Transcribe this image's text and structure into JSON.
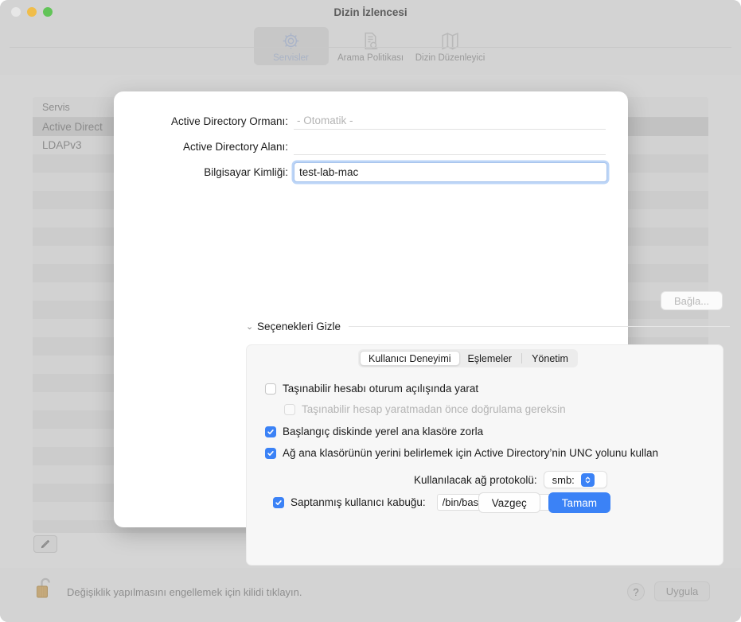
{
  "window": {
    "title": "Dizin İzlencesi",
    "traffic_lights": [
      "close",
      "minimize",
      "maximize"
    ]
  },
  "toolbar": {
    "items": [
      {
        "label": "Servisler",
        "icon": "gear-icon",
        "selected": true
      },
      {
        "label": "Arama Politikası",
        "icon": "document-search-icon",
        "selected": false
      },
      {
        "label": "Dizin Düzenleyici",
        "icon": "map-icon",
        "selected": false
      }
    ]
  },
  "service_list": {
    "header": "Servis",
    "rows": [
      {
        "label": "Active Direct",
        "selected": true
      },
      {
        "label": "LDAPv3",
        "selected": false
      }
    ],
    "empty_row_count": 21
  },
  "edit_button": {
    "icon": "pencil-icon"
  },
  "status_bar": {
    "lock_icon": "unlocked-padlock-icon",
    "message": "Değişiklik yapılmasını engellemek için kilidi tıklayın.",
    "help_label": "?",
    "apply_label": "Uygula"
  },
  "sheet": {
    "fields": [
      {
        "label": "Active Directory Ormanı:",
        "value": "",
        "placeholder": "- Otomatik -",
        "style": "plain"
      },
      {
        "label": "Active Directory Alanı:",
        "value": "",
        "placeholder": "",
        "style": "plain"
      },
      {
        "label": "Bilgisayar Kimliği:",
        "value": "test-lab-mac",
        "placeholder": "",
        "style": "focused"
      }
    ],
    "bind_button": "Bağla...",
    "disclosure": {
      "chevron": "chevron-down-icon",
      "label": "Seçenekleri Gizle"
    },
    "tabs": [
      {
        "label": "Kullanıcı Deneyimi",
        "selected": true
      },
      {
        "label": "Eşlemeler",
        "selected": false
      },
      {
        "label": "Yönetim",
        "selected": false
      }
    ],
    "checkboxes": [
      {
        "label": "Taşınabilir hesabı oturum açılışında yarat",
        "checked": false,
        "disabled": false,
        "indent": 0
      },
      {
        "label": "Taşınabilir hesap yaratmadan önce doğrulama gereksin",
        "checked": false,
        "disabled": true,
        "indent": 1
      },
      {
        "label": "Başlangıç diskinde yerel ana klasöre zorla",
        "checked": true,
        "disabled": false,
        "indent": 0
      },
      {
        "label": "Ağ ana klasörünün yerini belirlemek için Active Directory’nin UNC yolunu kullan",
        "checked": true,
        "disabled": false,
        "indent": 0
      }
    ],
    "protocol": {
      "label": "Kullanılacak ağ protokolü:",
      "value": "smb:",
      "badge": "updown-chevron-icon"
    },
    "shell": {
      "label": "Saptanmış kullanıcı kabuğu:",
      "checked": true,
      "value": "/bin/bash"
    },
    "footer": {
      "cancel": "Vazgeç",
      "ok": "Tamam"
    }
  },
  "colors": {
    "accent": "#3b82f6",
    "window_bg": "#d3d3d3",
    "sheet_bg": "#ffffff",
    "panel_bg": "#f7f7f7"
  }
}
